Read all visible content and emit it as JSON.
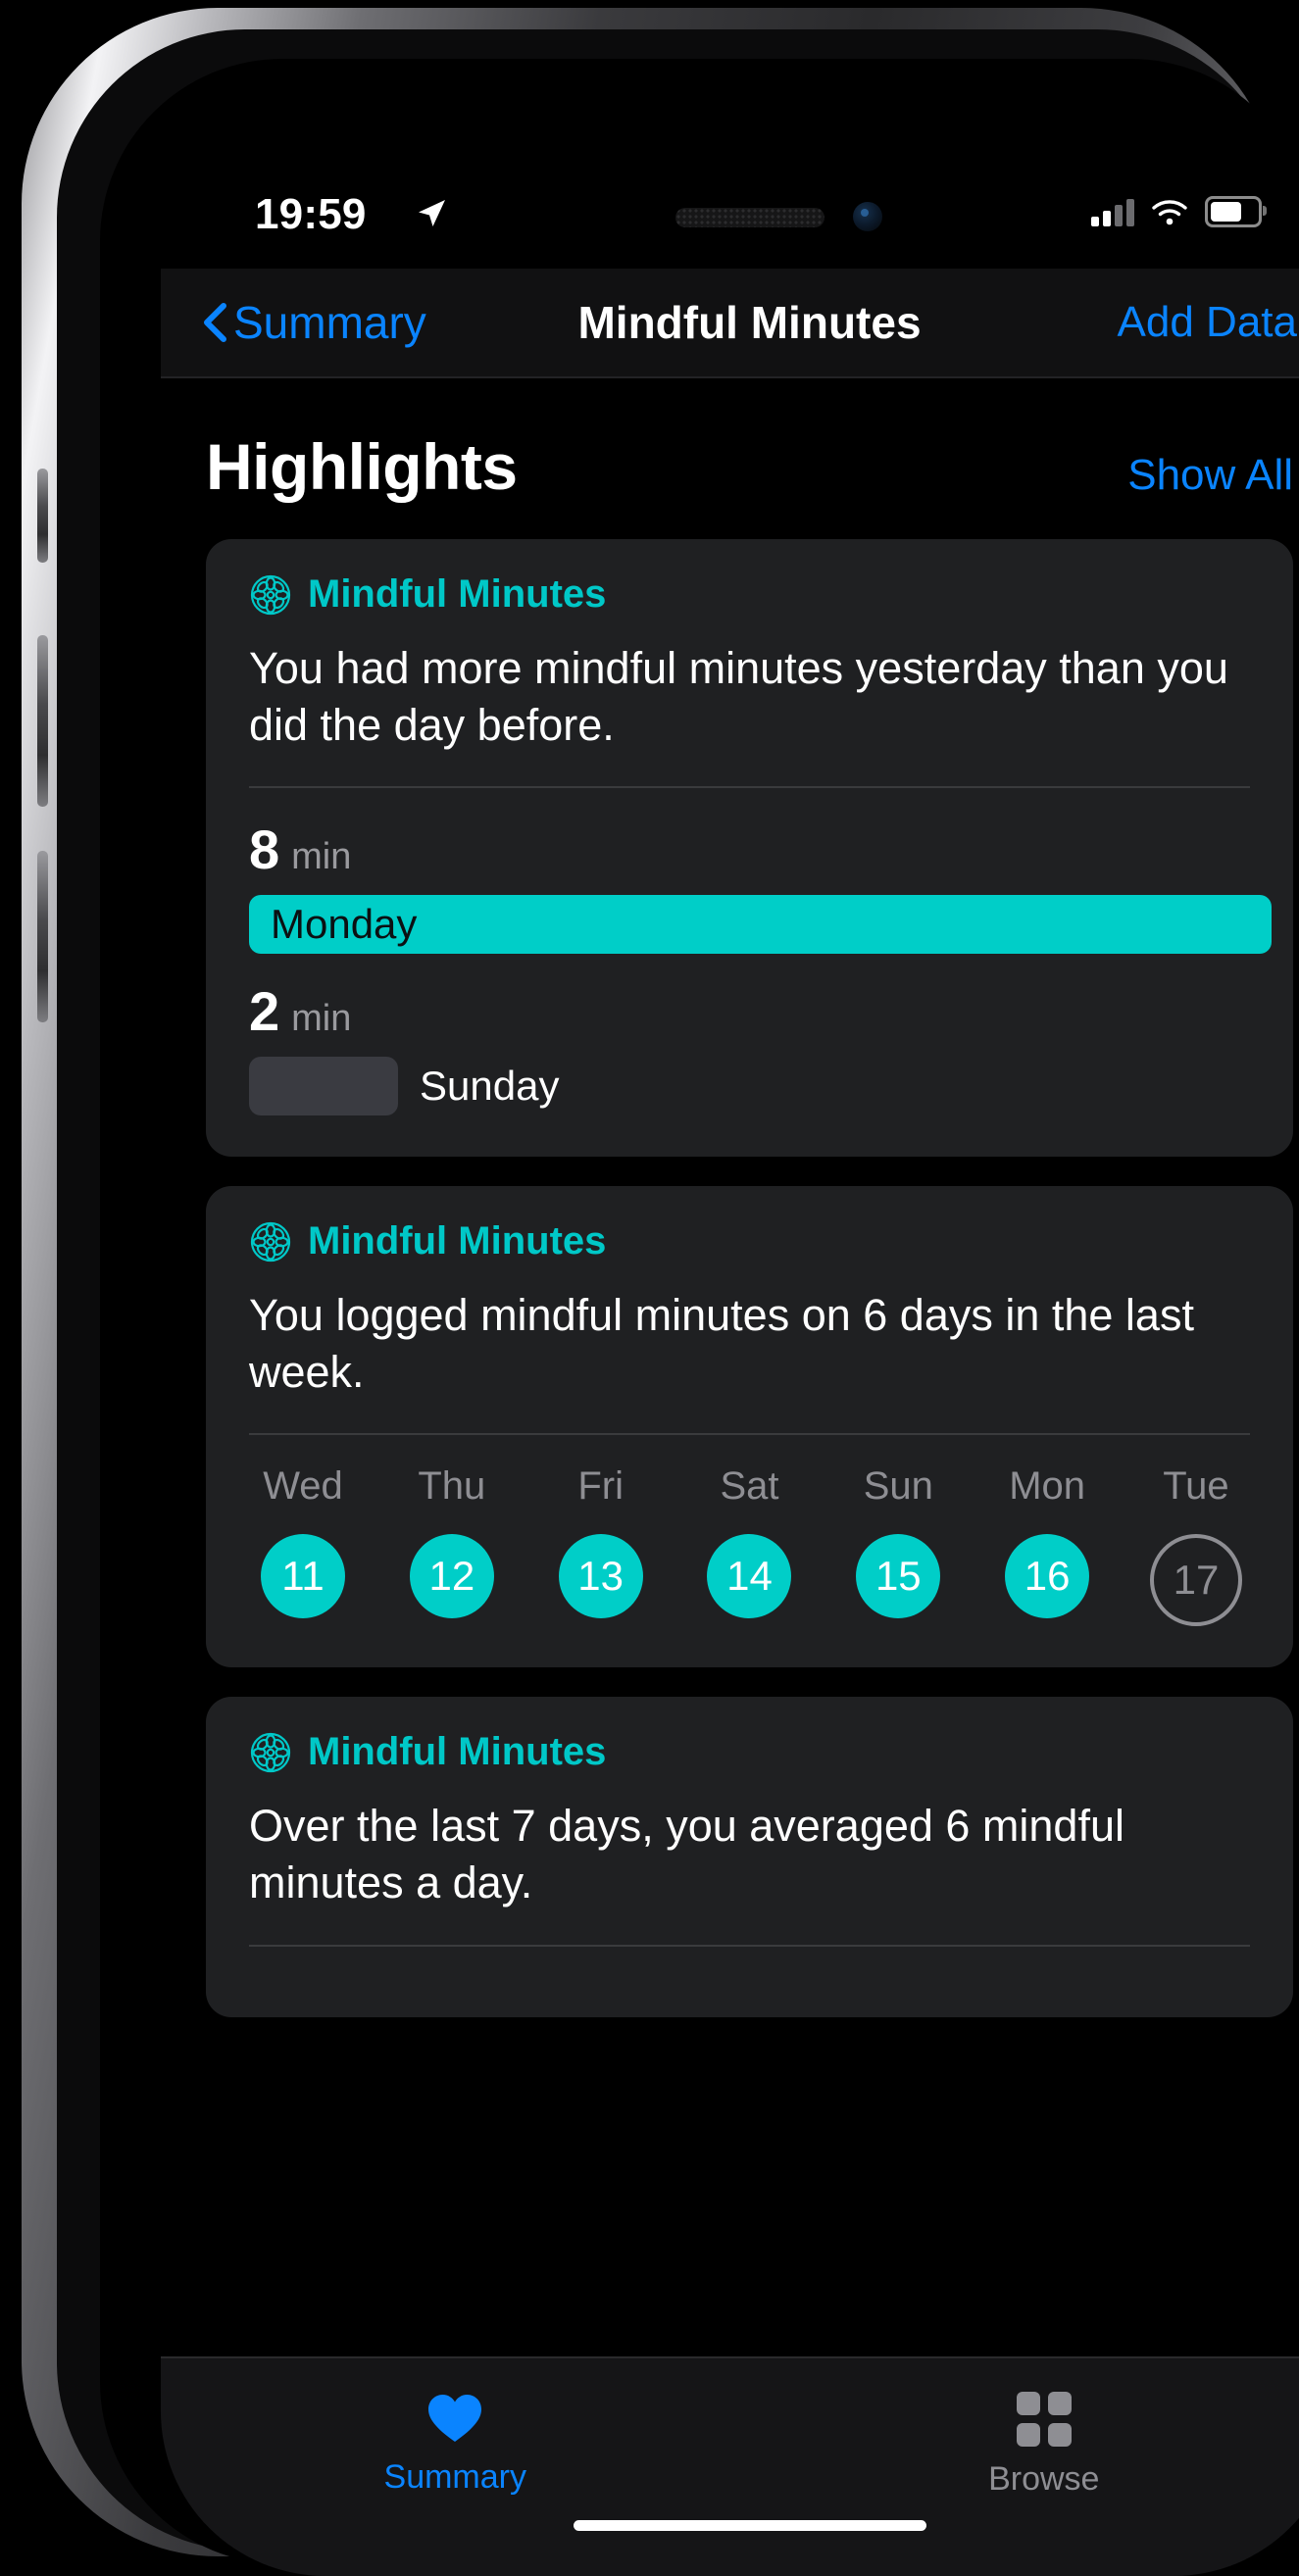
{
  "status_bar": {
    "time": "19:59",
    "location_icon": "location-arrow-icon",
    "signal_icon": "cellular-signal-icon",
    "wifi_icon": "wifi-icon",
    "battery_icon": "battery-icon"
  },
  "nav": {
    "back_label": "Summary",
    "title": "Mindful Minutes",
    "action_label": "Add Data"
  },
  "highlights": {
    "title": "Highlights",
    "show_all": "Show All"
  },
  "cards": [
    {
      "source_label": "Mindful Minutes",
      "body": "You had more mindful minutes yesterday than you did the day before.",
      "comparison": [
        {
          "value": "8",
          "unit": "min",
          "day": "Monday",
          "bar_style": "full"
        },
        {
          "value": "2",
          "unit": "min",
          "day": "Sunday",
          "bar_style": "small"
        }
      ]
    },
    {
      "source_label": "Mindful Minutes",
      "body": "You logged mindful minutes on 6 days in the last week.",
      "week": [
        {
          "name": "Wed",
          "date": "11",
          "logged": true
        },
        {
          "name": "Thu",
          "date": "12",
          "logged": true
        },
        {
          "name": "Fri",
          "date": "13",
          "logged": true
        },
        {
          "name": "Sat",
          "date": "14",
          "logged": true
        },
        {
          "name": "Sun",
          "date": "15",
          "logged": true
        },
        {
          "name": "Mon",
          "date": "16",
          "logged": true
        },
        {
          "name": "Tue",
          "date": "17",
          "logged": false
        }
      ]
    },
    {
      "source_label": "Mindful Minutes",
      "body": "Over the last 7 days, you averaged 6 mindful minutes a day."
    }
  ],
  "tabbar": [
    {
      "label": "Summary",
      "icon": "heart-icon",
      "active": true
    },
    {
      "label": "Browse",
      "icon": "grid-icon",
      "active": false
    }
  ],
  "colors": {
    "accent_teal": "#00cec8",
    "link_blue": "#0a84ff",
    "card_bg": "#1f2022",
    "muted_gray": "#8e8e93"
  }
}
